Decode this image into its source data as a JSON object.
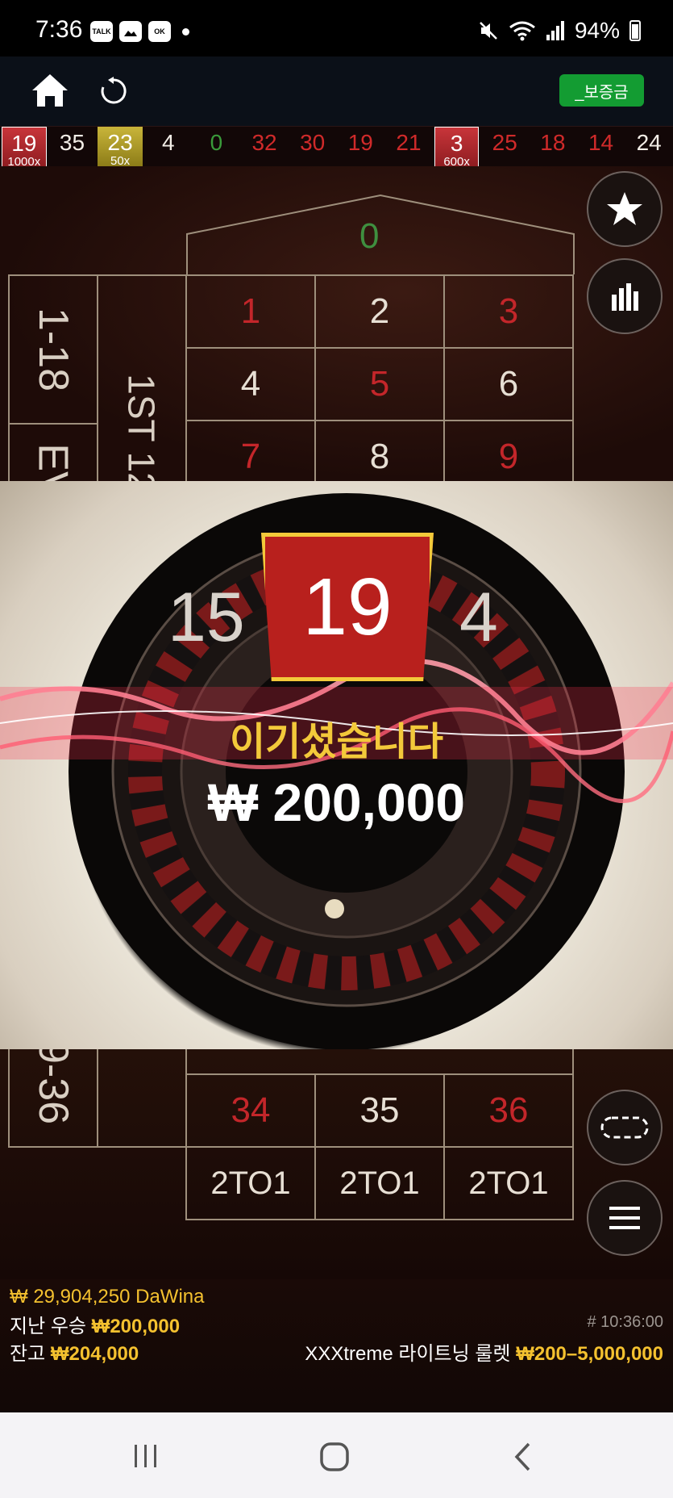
{
  "status_bar": {
    "time": "7:36",
    "notification_icons": [
      "talk-icon",
      "gallery-icon",
      "ok-icon",
      "dot-icon"
    ],
    "talk_label": "TALK",
    "ok_label": "OK",
    "battery": "94%"
  },
  "app_bar": {
    "deposit_label": "_보증금"
  },
  "history": [
    {
      "number": "19",
      "color": "red",
      "highlight": "red",
      "multiplier": "1000x"
    },
    {
      "number": "35",
      "color": "white"
    },
    {
      "number": "23",
      "color": "white",
      "highlight": "gold",
      "multiplier": "50x"
    },
    {
      "number": "4",
      "color": "white"
    },
    {
      "number": "0",
      "color": "green"
    },
    {
      "number": "32",
      "color": "red"
    },
    {
      "number": "30",
      "color": "red"
    },
    {
      "number": "19",
      "color": "red"
    },
    {
      "number": "21",
      "color": "red"
    },
    {
      "number": "3",
      "color": "red",
      "highlight": "red",
      "multiplier": "600x"
    },
    {
      "number": "25",
      "color": "red"
    },
    {
      "number": "18",
      "color": "red"
    },
    {
      "number": "14",
      "color": "red"
    },
    {
      "number": "24",
      "color": "white"
    }
  ],
  "table": {
    "zero": "0",
    "rows_top": [
      [
        "1",
        "2",
        "3"
      ],
      [
        "4",
        "5",
        "6"
      ],
      [
        "7",
        "8",
        "9"
      ]
    ],
    "rows_top_colors": [
      [
        "red",
        "white",
        "red"
      ],
      [
        "white",
        "red",
        "white"
      ],
      [
        "red",
        "white",
        "red"
      ]
    ],
    "side_1_18": "1-18",
    "side_even": "EV",
    "dozen_first": "1ST 12",
    "rows_bottom": [
      [
        "34",
        "35",
        "36"
      ]
    ],
    "rows_bottom_colors": [
      [
        "red",
        "white",
        "red"
      ]
    ],
    "side_19_36": "9-36",
    "two_to_one": [
      "2TO1",
      "2TO1",
      "2TO1"
    ]
  },
  "side_buttons": [
    "star-icon",
    "stats-icon",
    "chip-icon",
    "menu-icon"
  ],
  "win_overlay": {
    "winning_number": "19",
    "left_number": "15",
    "right_number": "4",
    "title": "이기셨습니다",
    "amount": "₩ 200,000"
  },
  "info": {
    "top_winner": "₩ 29,904,250 DaWina",
    "last_win_label": "지난 우승",
    "last_win_value": "₩200,000",
    "balance_label": "잔고",
    "balance_value": "₩204,000",
    "round_id": "# 10:36:00",
    "game_name": "XXXtreme 라이트닝 룰렛",
    "bet_limits": "₩200–5,000,000"
  },
  "colors": {
    "red": "#c3262a",
    "gold": "#f4c12f",
    "green": "#139c32"
  }
}
